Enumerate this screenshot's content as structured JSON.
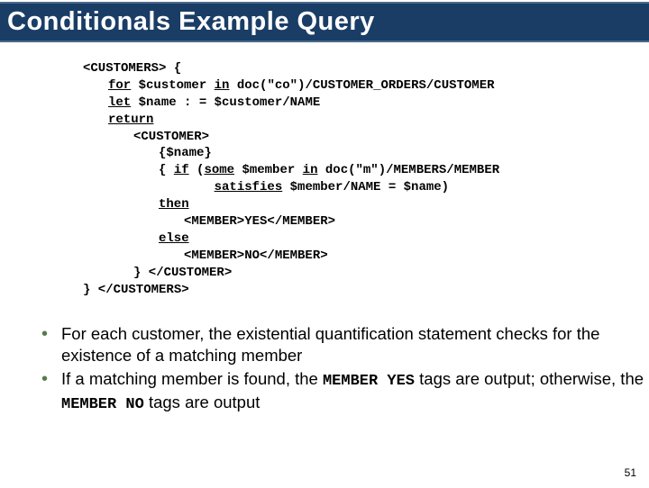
{
  "title": "Conditionals Example Query",
  "code": {
    "l1a": "<CUSTOMERS> {",
    "l2_kw": "for",
    "l2a": " $customer ",
    "l2_kw2": "in",
    "l2b": " doc(\"co\")/CUSTOMER_ORDERS/CUSTOMER",
    "l3_kw": "let",
    "l3a": " $name : = $customer/NAME",
    "l4_kw": "return",
    "l5": "<CUSTOMER>",
    "l6": "{$name}",
    "l7a": "{ ",
    "l7_kw1": "if",
    "l7b": " (",
    "l7_kw2": "some",
    "l7c": " $member ",
    "l7_kw3": "in",
    "l7d": " doc(\"m\")/MEMBERS/MEMBER",
    "l8_kw": "satisfies",
    "l8a": " $member/NAME = $name)",
    "l9_kw": "then",
    "l10": "<MEMBER>YES</MEMBER>",
    "l11_kw": "else",
    "l12": "<MEMBER>NO</MEMBER>",
    "l13": "} </CUSTOMER>",
    "l14": "} </CUSTOMERS>"
  },
  "bullets": {
    "b1": "For each customer, the existential quantification statement checks for the existence of a matching member",
    "b2a": "If a matching member is found, the ",
    "b2_mono1": "MEMBER YES",
    "b2b": " tags are output; otherwise, the ",
    "b2_mono2": "MEMBER NO",
    "b2c": " tags are output"
  },
  "page_number": "51"
}
